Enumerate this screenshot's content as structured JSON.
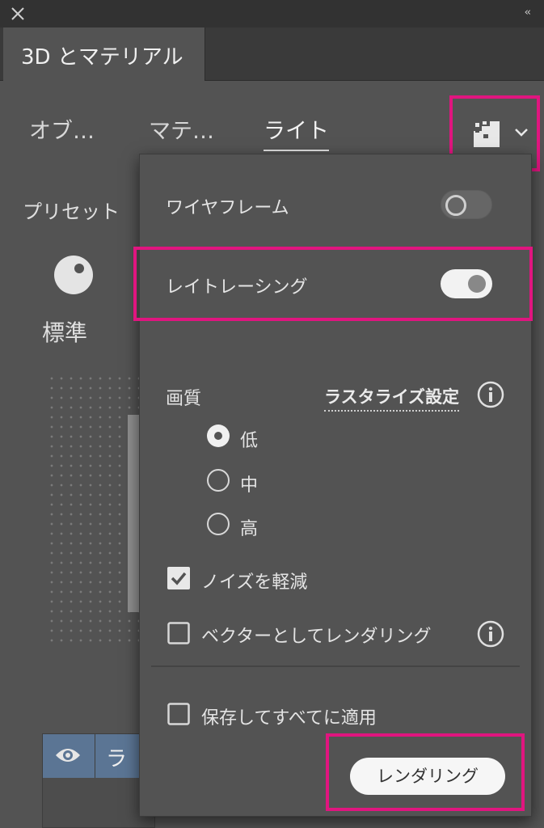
{
  "window": {
    "close_icon": "close-icon",
    "collapse_glyph": "‹‹"
  },
  "panel": {
    "title": "3D とマテリアル"
  },
  "subtabs": [
    {
      "label": "オブ…"
    },
    {
      "label": "マテ…"
    },
    {
      "label": "ライト",
      "active": true
    }
  ],
  "render_dropdown": {
    "icon": "render-options-icon",
    "chevron": "chevron-down-icon"
  },
  "preset": {
    "label": "プリセット",
    "name": "標準"
  },
  "lights_list": {
    "name_partial": "ラ"
  },
  "popover": {
    "wireframe": {
      "label": "ワイヤフレーム",
      "enabled": false
    },
    "raytracing": {
      "label": "レイトレーシング",
      "enabled": true
    },
    "quality": {
      "label": "画質",
      "raster_link": "ラスタライズ設定",
      "options": [
        {
          "label": "低",
          "selected": true
        },
        {
          "label": "中",
          "selected": false
        },
        {
          "label": "高",
          "selected": false
        }
      ]
    },
    "reduce_noise": {
      "label": "ノイズを軽減",
      "checked": true
    },
    "render_as_vector": {
      "label": "ベクターとしてレンダリング",
      "checked": false
    },
    "save_apply_all": {
      "label": "保存してすべてに適用",
      "checked": false
    },
    "render_button": "レンダリング"
  },
  "colors": {
    "highlight": "#e0157f",
    "panel_bg": "#535353",
    "selected_row": "#5b7594"
  }
}
